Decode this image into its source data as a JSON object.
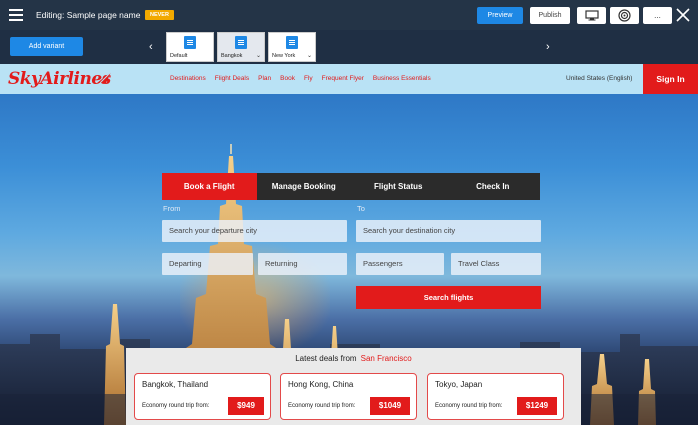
{
  "editor": {
    "title": "Editing: Sample page name",
    "badge": "NEVER",
    "preview_label": "Preview",
    "publish_label": "Publish",
    "more_label": "...",
    "icons": [
      "menu-icon",
      "monitor-icon",
      "target-icon",
      "close-icon"
    ]
  },
  "variants": {
    "add_label": "Add variant",
    "items": [
      {
        "label": "Default",
        "has_dropdown": false
      },
      {
        "label": "Bangkok",
        "has_dropdown": true
      },
      {
        "label": "New York",
        "has_dropdown": true
      }
    ]
  },
  "site": {
    "logo": "SkyAirlines",
    "nav": [
      "Destinations",
      "Flight Deals",
      "Plan",
      "Book",
      "Fly",
      "Frequent Flyer",
      "Business Essentials"
    ],
    "region": "United States (English)",
    "signin": "Sign In",
    "brand_color": "#e21b1b"
  },
  "booking": {
    "tabs": [
      "Book a Flight",
      "Manage Booking",
      "Flight Status",
      "Check In"
    ],
    "active_tab": "Book a Flight",
    "from_label": "From",
    "to_label": "To",
    "from_placeholder": "Search your departure city",
    "to_placeholder": "Search your destination city",
    "departing": "Departing",
    "returning": "Returning",
    "passengers": "Passengers",
    "travel_class": "Travel Class",
    "search_label": "Search flights"
  },
  "deals": {
    "heading": "Latest deals from",
    "city": "San Francisco",
    "items": [
      {
        "destination": "Bangkok, Thailand",
        "note": "Economy round trip from:",
        "price": "$949"
      },
      {
        "destination": "Hong Kong, China",
        "note": "Economy round trip from:",
        "price": "$1049"
      },
      {
        "destination": "Tokyo, Japan",
        "note": "Economy round trip from:",
        "price": "$1249"
      }
    ]
  }
}
